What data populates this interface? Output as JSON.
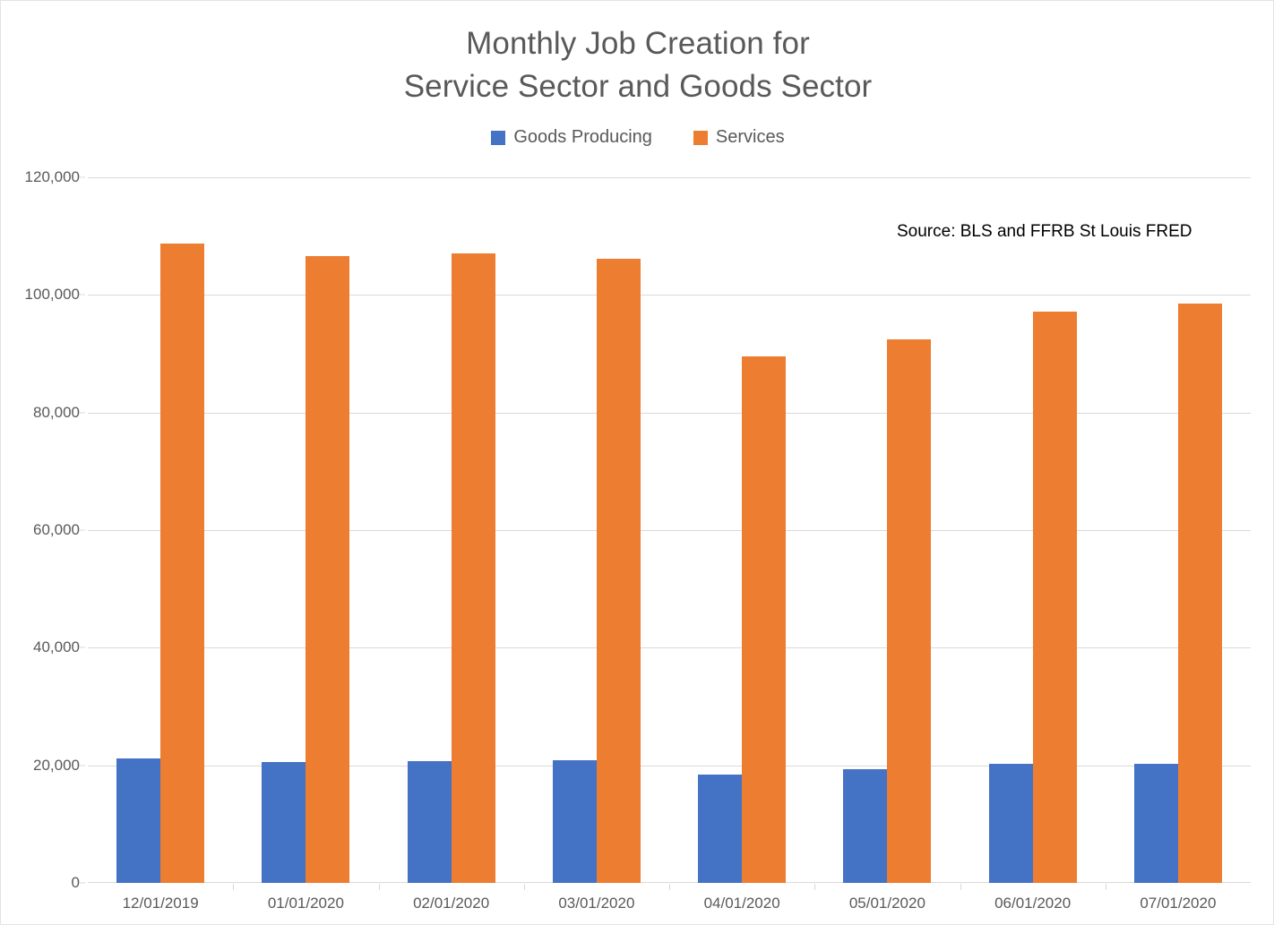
{
  "chart_data": {
    "type": "bar",
    "title": "Monthly Job Creation for Service Sector and Goods Sector",
    "title_lines": [
      "Monthly Job Creation for",
      "Service Sector and Goods Sector"
    ],
    "xlabel": "",
    "ylabel": "",
    "categories": [
      "12/01/2019",
      "01/01/2020",
      "02/01/2020",
      "03/01/2020",
      "04/01/2020",
      "05/01/2020",
      "06/01/2020",
      "07/01/2020"
    ],
    "series": [
      {
        "name": "Goods Producing",
        "color": "#4472C4",
        "values": [
          21100,
          20600,
          20700,
          20800,
          18500,
          19400,
          20200,
          20200
        ]
      },
      {
        "name": "Services",
        "color": "#ED7D31",
        "values": [
          108800,
          106600,
          107100,
          106200,
          89600,
          92400,
          97100,
          98500
        ]
      }
    ],
    "ylim": [
      0,
      120000
    ],
    "y_tick_values": [
      0,
      20000,
      40000,
      60000,
      80000,
      100000,
      120000
    ],
    "y_tick_labels": [
      "0",
      "20,000",
      "40,000",
      "60,000",
      "80,000",
      "100,000",
      "120,000"
    ],
    "grid": true,
    "legend_position": "top",
    "annotations": [
      {
        "name": "source-note",
        "text": "Source: BLS and FFRB St Louis FRED"
      }
    ]
  }
}
